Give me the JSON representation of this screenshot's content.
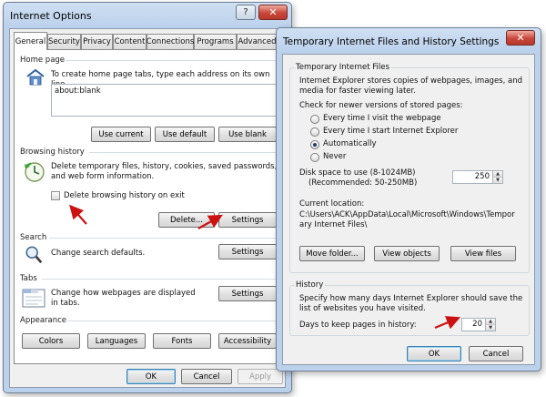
{
  "internet_options": {
    "title": "Internet Options",
    "help_label": "?",
    "close_label": "✕",
    "tabs": [
      "General",
      "Security",
      "Privacy",
      "Content",
      "Connections",
      "Programs",
      "Advanced"
    ],
    "active_tab": "General",
    "home_page": {
      "section_label": "Home page",
      "description": "To create home page tabs, type each address on its own line.",
      "value": "about:blank",
      "buttons": [
        "Use current",
        "Use default",
        "Use blank"
      ]
    },
    "browsing_history": {
      "section_label": "Browsing history",
      "description": "Delete temporary files, history, cookies, saved passwords, and web form information.",
      "checkbox_label": "Delete browsing history on exit",
      "checkbox_checked": false,
      "delete_button": "Delete...",
      "settings_button": "Settings"
    },
    "search": {
      "section_label": "Search",
      "description": "Change search defaults.",
      "settings_button": "Settings"
    },
    "tabs_section": {
      "section_label": "Tabs",
      "description": "Change how webpages are displayed in tabs.",
      "settings_button": "Settings"
    },
    "appearance": {
      "section_label": "Appearance",
      "buttons": [
        "Colors",
        "Languages",
        "Fonts",
        "Accessibility"
      ]
    },
    "footer": {
      "ok": "OK",
      "cancel": "Cancel",
      "apply": "Apply"
    }
  },
  "temp_files_dialog": {
    "title": "Temporary Internet Files and History Settings",
    "close_label": "✕",
    "temp_group": {
      "title": "Temporary Internet Files",
      "description": "Internet Explorer stores copies of webpages, images, and media for faster viewing later.",
      "check_label": "Check for newer versions of stored pages:",
      "options": [
        "Every time I visit the webpage",
        "Every time I start Internet Explorer",
        "Automatically",
        "Never"
      ],
      "selected_option": "Automatically",
      "disk_space_label": "Disk space to use (8-1024MB)",
      "disk_space_recommended": "(Recommended: 50-250MB)",
      "disk_space_value": "250",
      "current_location_label": "Current location:",
      "current_location_path": "C:\\Users\\ACK\\AppData\\Local\\Microsoft\\Windows\\Temporary Internet Files\\",
      "buttons": [
        "Move folder...",
        "View objects",
        "View files"
      ]
    },
    "history_group": {
      "title": "History",
      "description": "Specify how many days Internet Explorer should save the list of websites you have visited.",
      "days_label": "Days to keep pages in history:",
      "days_value": "20"
    },
    "footer": {
      "ok": "OK",
      "cancel": "Cancel"
    }
  },
  "annotation_arrow_color": "#cc1111"
}
